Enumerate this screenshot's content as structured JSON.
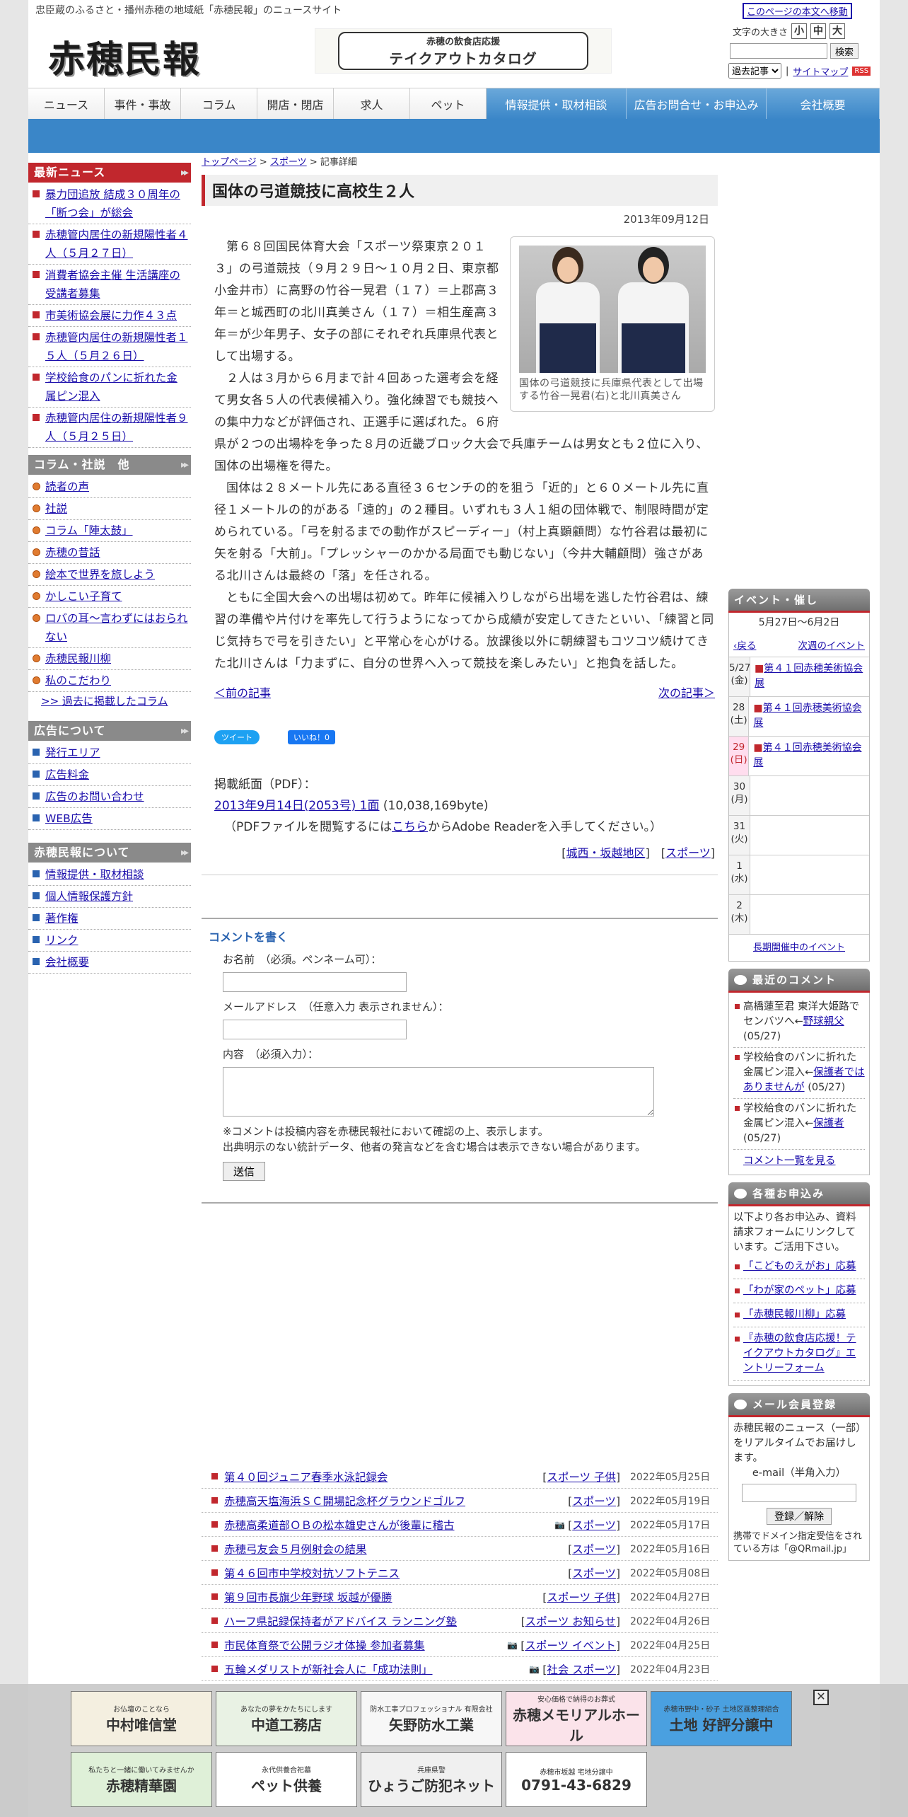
{
  "header": {
    "tagline": "忠臣蔵のふるさと・播州赤穂の地域紙「赤穂民報」のニュースサイト",
    "logo": "赤穂民報",
    "banner_line1": "赤穂の飲食店応援",
    "banner_line2": "テイクアウトカタログ",
    "skip_link": "このページの本文へ移動",
    "fontsize_label": "文字の大きさ",
    "fontsize_small": "小",
    "fontsize_medium": "中",
    "fontsize_large": "大",
    "search_button": "検索",
    "archive_select": "過去記事",
    "sitemap": "サイトマップ",
    "rss": "RSS"
  },
  "nav": [
    "ニュース",
    "事件・事故",
    "コラム",
    "開店・閉店",
    "求人",
    "ペット",
    "情報提供・取材相談",
    "広告お問合せ・お申込み",
    "会社概要"
  ],
  "sidebar": {
    "latest_title": "最新ニュース",
    "latest": [
      "暴力団追放 結成３０周年の「断つ会」が総会",
      "赤穂管内居住の新規陽性者４人（５月２７日）",
      "消費者協会主催 生活講座の受講者募集",
      "市美術協会展に力作４３点",
      "赤穂管内居住の新規陽性者１５人（５月２６日）",
      "学校給食のパンに折れた金属ピン混入",
      "赤穂管内居住の新規陽性者９人（５月２５日）"
    ],
    "column_title": "コラム・社説　他",
    "columns": [
      "読者の声",
      "社説",
      "コラム「陣太鼓」",
      "赤穂の昔話",
      "絵本で世界を旅しよう",
      "かしこい子育て",
      "ロバの耳～言わずにはおられない",
      "赤穂民報川柳",
      "私のこだわり"
    ],
    "columns_more": ">> 過去に掲載したコラム",
    "ad_title": "広告について",
    "ads": [
      "発行エリア",
      "広告料金",
      "広告のお問い合わせ",
      "WEB広告"
    ],
    "about_title": "赤穂民報について",
    "about": [
      "情報提供・取材相談",
      "個人情報保護方針",
      "著作権",
      "リンク",
      "会社概要"
    ]
  },
  "article": {
    "breadcrumb": [
      "トップページ",
      ">",
      "スポーツ",
      ">",
      "記事詳細"
    ],
    "title": "国体の弓道競技に高校生２人",
    "date": "2013年09月12日",
    "photo_caption": "国体の弓道競技に兵庫県代表として出場する竹谷一晃君(右)と北川真美さん",
    "paragraphs": [
      "第６８回国民体育大会「スポーツ祭東京２０１３」の弓道競技（９月２９日～１０月２日、東京都小金井市）に高野の竹谷一晃君（１７）＝上郡高３年＝と城西町の北川真美さん（１７）＝相生産高３年＝が少年男子、女子の部にそれぞれ兵庫県代表として出場する。",
      "２人は３月から６月まで計４回あった選考会を経て男女各５人の代表候補入り。強化練習でも競技への集中力などが評価され、正選手に選ばれた。６府県が２つの出場枠を争った８月の近畿ブロック大会で兵庫チームは男女とも２位に入り、国体の出場権を得た。",
      "国体は２８メートル先にある直径３６センチの的を狙う「近的」と６０メートル先に直径１メートルの的がある「遠的」の２種目。いずれも３人１組の団体戦で、制限時間が定められている。「弓を射るまでの動作がスピーディー」（村上真顕顧問）な竹谷君は最初に矢を射る「大前」。「プレッシャーのかかる局面でも動じない」（今井大輔顧問）強さがある北川さんは最終の「落」を任される。",
      "ともに全国大会への出場は初めて。昨年に候補入りしながら出場を逃した竹谷君は、練習の準備や片付けを率先して行うようになってから成績が安定してきたといい、「練習と同じ気持ちで弓を引きたい」と平常心を心がける。放課後以外に朝練習もコツコツ続けてきた北川さんは「力まずに、自分の世界へ入って競技を楽しみたい」と抱負を話した。"
    ],
    "prev": "＜前の記事",
    "next": "次の記事＞",
    "tweet": "ツイート",
    "like": "いいね！0",
    "pdf_label": "掲載紙面（PDF）：",
    "pdf_link": "2013年9月14日(2053号) 1面",
    "pdf_size": "(10,038,169byte)",
    "pdf_note_a": "（PDFファイルを閲覧するには",
    "pdf_note_link": "こちら",
    "pdf_note_b": "からAdobe Readerを入手してください。）",
    "tag_area": "城西・坂越地区",
    "tag_cat": "スポーツ"
  },
  "comment_form": {
    "heading": "コメントを書く",
    "name_label": "お名前　（必須。ペンネーム可）：",
    "email_label": "メールアドレス　（任意入力 表示されません）：",
    "content_label": "内容　（必須入力）：",
    "note1": "※コメントは投稿内容を赤穂民報社において確認の上、表示します。",
    "note2": "出典明示のない統計データ、他者の発言などを含む場合は表示できない場合があります。",
    "submit": "送信"
  },
  "news_list": [
    {
      "title": "第４０回ジュニア春季水泳記録会",
      "cats": "スポーツ 子供",
      "date": "2022年05月25日",
      "cam": false
    },
    {
      "title": "赤穂高天塩海浜ＳＣ開場記念杯グラウンドゴルフ",
      "cats": "スポーツ",
      "date": "2022年05月19日",
      "cam": false
    },
    {
      "title": "赤穂高柔道部ＯＢの松本雄史さんが後輩に稽古",
      "cats": "スポーツ",
      "date": "2022年05月17日",
      "cam": true
    },
    {
      "title": "赤穂弓友会５月例射会の結果",
      "cats": "スポーツ",
      "date": "2022年05月16日",
      "cam": false
    },
    {
      "title": "第４６回市中学校対抗ソフトテニス",
      "cats": "スポーツ",
      "date": "2022年05月08日",
      "cam": false
    },
    {
      "title": "第９回市長旗少年野球 坂越が優勝",
      "cats": "スポーツ 子供",
      "date": "2022年04月27日",
      "cam": false
    },
    {
      "title": "ハーフ県記録保持者がアドバイス ランニング塾",
      "cats": "スポーツ お知らせ",
      "date": "2022年04月26日",
      "cam": false
    },
    {
      "title": "市民体育祭で公開ラジオ体操 参加者募集",
      "cats": "スポーツ イベント",
      "date": "2022年04月25日",
      "cam": true
    },
    {
      "title": "五輪メダリストが新社会人に「成功法則」",
      "cats": "社会 スポーツ",
      "date": "2022年04月23日",
      "cam": true
    }
  ],
  "events": {
    "title": "イベント・催し",
    "range": "5月27日～6月2日",
    "prev": "戻る",
    "next": "次週のイベント",
    "days": [
      {
        "day": "5/27",
        "dow": "(金)",
        "type": "normal",
        "event": "第４１回赤穂美術協会展"
      },
      {
        "day": "28",
        "dow": "(土)",
        "type": "sat",
        "event": "第４１回赤穂美術協会展"
      },
      {
        "day": "29",
        "dow": "(日)",
        "type": "sun",
        "event": "第４１回赤穂美術協会展"
      },
      {
        "day": "30",
        "dow": "(月)",
        "type": "normal",
        "event": ""
      },
      {
        "day": "31",
        "dow": "(火)",
        "type": "normal",
        "event": ""
      },
      {
        "day": "1",
        "dow": "(水)",
        "type": "normal",
        "event": ""
      },
      {
        "day": "2",
        "dow": "(木)",
        "type": "normal",
        "event": ""
      }
    ],
    "more": "長期開催中のイベント"
  },
  "recent_comments": {
    "title": "最近のコメント",
    "items": [
      {
        "author": "高橋蓮至君 東洋大姫路でセンバツへ←",
        "link": "野球親父",
        "date": "(05/27)"
      },
      {
        "author": "学校給食のパンに折れた金属ピン混入←",
        "link": "保護者ではありませんが",
        "date": "(05/27)"
      },
      {
        "author": "学校給食のパンに折れた金属ピン混入←",
        "link": "保護者",
        "date": "(05/27)"
      }
    ],
    "more": "コメント一覧を見る"
  },
  "applications": {
    "title": "各種お申込み",
    "intro": "以下より各お申込み、資料請求フォームにリンクしています。ご活用下さい。",
    "items": [
      "「こどものえがお」応募",
      "「わが家のペット」応募",
      "「赤穂民報川柳」応募",
      "『赤穂の飲食店応援！テイクアウトカタログ』エントリーフォーム"
    ]
  },
  "mail": {
    "title": "メール会員登録",
    "intro": "赤穂民報のニュース（一部）をリアルタイムでお届けします。",
    "label": "e-mail（半角入力）",
    "button": "登録／解除",
    "note": "携帯でドメイン指定受信をされている方は「@QRmail.jp」"
  },
  "ads_bar": [
    {
      "small": "お仏壇のことなら",
      "big": "中村唯信堂"
    },
    {
      "small": "あなたの夢をかたちにします",
      "big": "中道工務店"
    },
    {
      "small": "防水工事プロフェッショナル 有限会社",
      "big": "矢野防水工業"
    },
    {
      "small": "安心価格で納得のお葬式",
      "big": "赤穂メモリアルホール"
    },
    {
      "small": "赤穂市野中・砂子 土地区画整理組合",
      "big": "土地 好評分譲中"
    },
    {
      "small": "私たちと一緒に働いてみませんか",
      "big": "赤穂精華園"
    },
    {
      "small": "永代供養合祀墓",
      "big": "ペット供養"
    },
    {
      "small": "兵庫県警",
      "big": "ひょうご防犯ネット"
    },
    {
      "small": "赤穂市坂越 宅地分譲中",
      "big": "0791-43-6829"
    }
  ]
}
